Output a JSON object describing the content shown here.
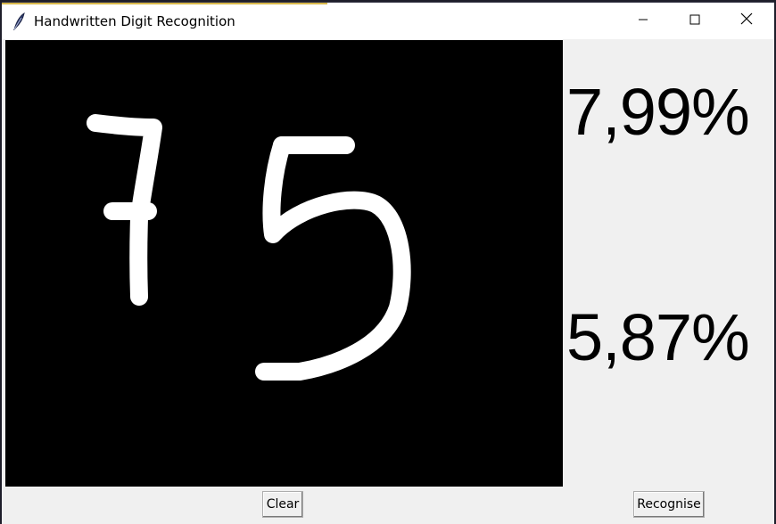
{
  "window": {
    "title": "Handwritten Digit Recognition",
    "icon": "feather-icon",
    "controls": [
      "minimize-icon",
      "maximize-icon",
      "close-icon"
    ]
  },
  "canvas": {
    "background": "#000000",
    "stroke_color": "#ffffff",
    "drawn_digits": [
      "7",
      "5"
    ]
  },
  "predictions": [
    "7,99%",
    "5,87%"
  ],
  "buttons": {
    "clear": "Clear",
    "recognise": "Recognise"
  }
}
